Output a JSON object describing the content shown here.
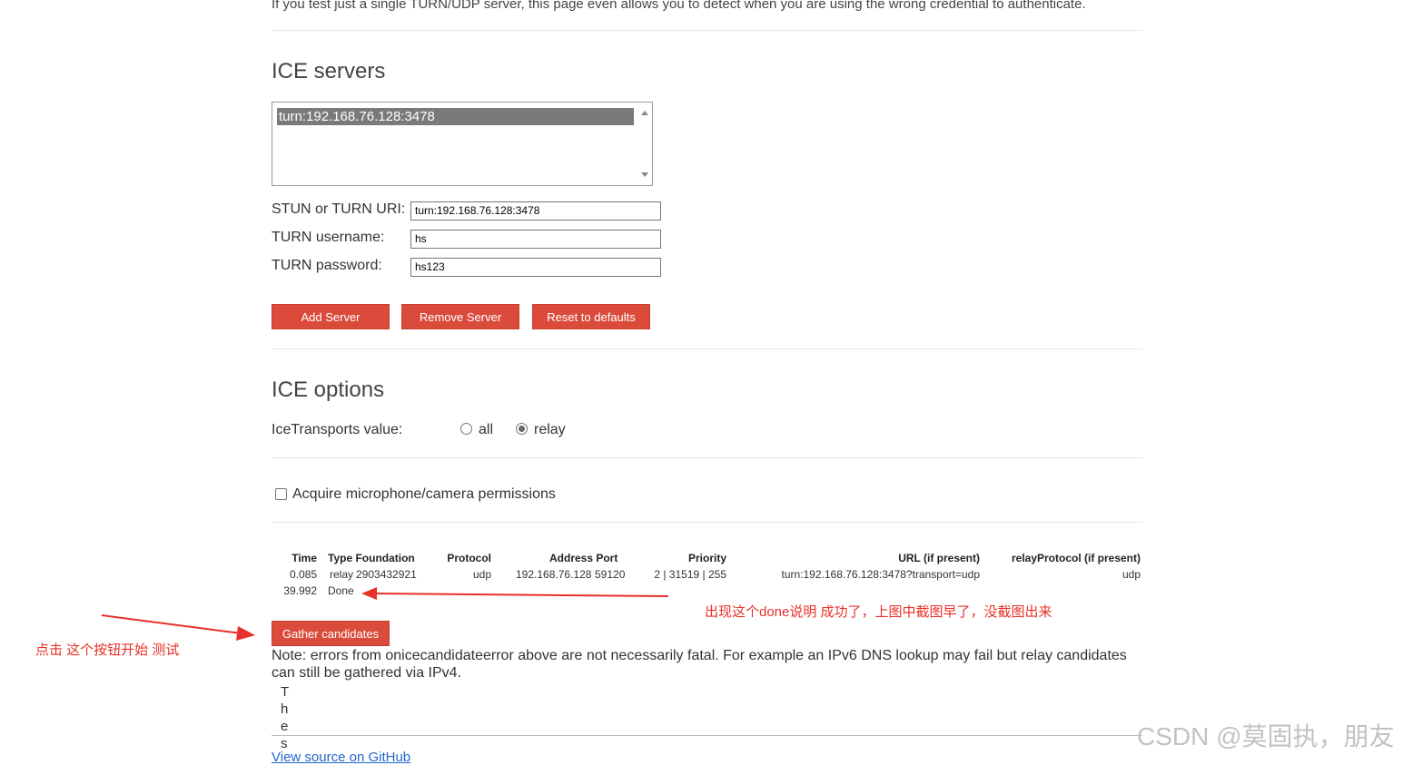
{
  "intro": {
    "text": "If you test just a single TURN/UDP server, this page even allows you to detect when you are using the wrong credential to authenticate."
  },
  "ice_servers": {
    "title": "ICE servers",
    "list_items": [
      "turn:192.168.76.128:3478"
    ],
    "fields": {
      "uri_label": "STUN or TURN URI:",
      "uri_value": "turn:192.168.76.128:3478",
      "username_label": "TURN username:",
      "username_value": "hs",
      "password_label": "TURN password:",
      "password_value": "hs123"
    },
    "buttons": {
      "add": "Add Server",
      "remove": "Remove Server",
      "reset": "Reset to defaults"
    }
  },
  "ice_options": {
    "title": "ICE options",
    "transports_label": "IceTransports value:",
    "radio_all": "all",
    "radio_relay": "relay",
    "selected": "relay",
    "permissions_label": "Acquire microphone/camera permissions"
  },
  "candidates": {
    "headers": {
      "time": "Time",
      "type_foundation": "Type Foundation",
      "protocol": "Protocol",
      "address_port": "Address Port",
      "priority": "Priority",
      "url": "URL (if present)",
      "relay_protocol": "relayProtocol (if present)"
    },
    "row1": {
      "time": "0.085",
      "type": "relay",
      "foundation": "2903432921",
      "protocol": "udp",
      "address": "192.168.76.128",
      "port": "59120",
      "priority": "2 | 31519 | 255",
      "url": "turn:192.168.76.128:3478?transport=udp",
      "relay_protocol": "udp"
    },
    "row2": {
      "time": "39.992",
      "status": "Done"
    },
    "gather_button": "Gather candidates"
  },
  "note": "Note: errors from onicecandidateerror above are not necessarily fatal. For example an IPv6 DNS lookup may fail but relay candidates can still be gathered via IPv4.",
  "vertical_chars": [
    "T",
    "h",
    "e",
    "s"
  ],
  "footer_link": "View source on GitHub",
  "annotations": {
    "left": "点击 这个按钮开始 测试",
    "right": "出现这个done说明 成功了，上图中截图早了，没截图出来",
    "color": "#e8302a"
  },
  "watermark": "CSDN @莫固执，朋友",
  "colors": {
    "button": "#db4b3b",
    "annotation": "#e8302a"
  }
}
